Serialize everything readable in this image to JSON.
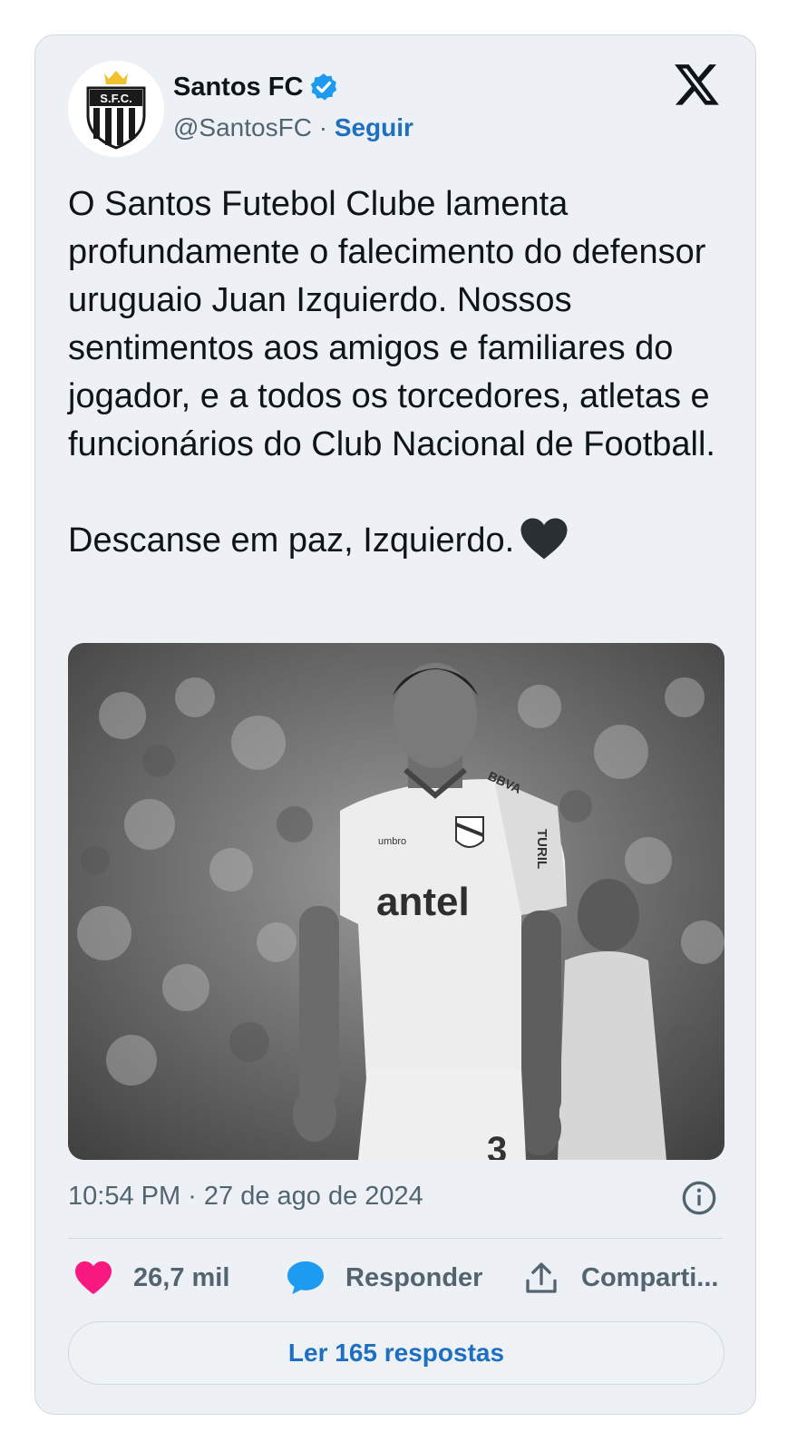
{
  "author": {
    "display_name": "Santos FC",
    "handle": "@SantosFC",
    "separator": "·",
    "follow_label": "Seguir",
    "avatar_monogram": "S.F.C."
  },
  "tweet": {
    "text": "O Santos Futebol Clube lamenta profundamente o falecimento do defensor uruguaio Juan Izquierdo. Nossos sentimentos aos amigos e familiares do jogador, e a todos os torcedores, atletas e funcionários do Club Nacional de Football.\n\nDescanse em paz, Izquierdo.",
    "emoji": "black-heart",
    "timestamp": "10:54 PM · 27 de ago de 2024"
  },
  "media": {
    "jersey_text": "antel",
    "sponsor_text": "BBVA",
    "brand_text": "umbro",
    "side_text": "TURIL",
    "number_text": "3"
  },
  "actions": {
    "likes": "26,7 mil",
    "reply_label": "Responder",
    "share_label": "Comparti..."
  },
  "read_replies_label": "Ler 165 respostas",
  "colors": {
    "card_bg": "#edf1f5",
    "link_blue": "#1d6fc1",
    "like_pink": "#f91880",
    "reply_blue": "#1d9bf0",
    "muted_text": "#536471"
  }
}
